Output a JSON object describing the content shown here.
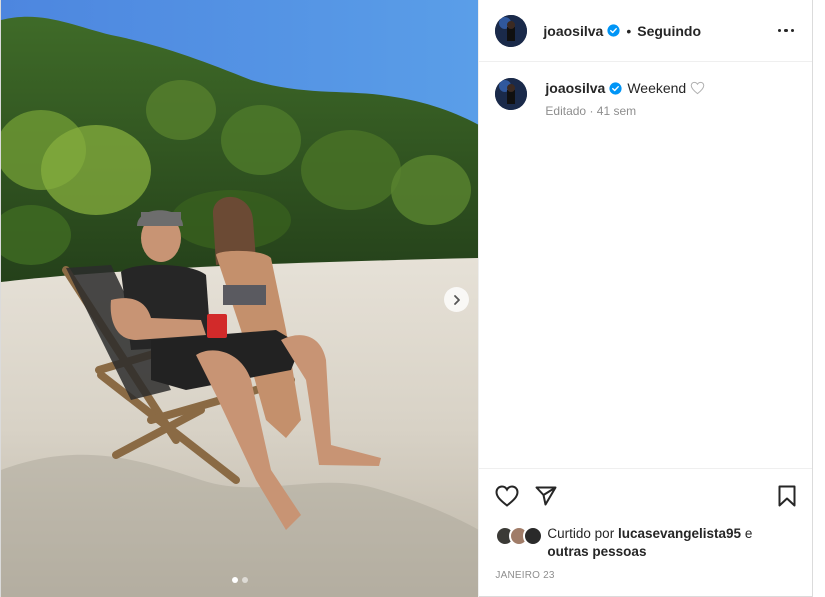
{
  "post": {
    "username": "joaosilva",
    "follow_separator": "•",
    "follow_state": "Seguindo",
    "more_icon": "more-horizontal-icon",
    "caption": {
      "username": "joaosilva",
      "text": "Weekend",
      "meta": "Editado · 41 sem"
    },
    "likes": {
      "prefix": "Curtido por",
      "user": "lucasevangelista95",
      "conjunction": "e",
      "others": "outras pessoas"
    },
    "date": "JANEIRO 23",
    "carousel": {
      "count": 2,
      "active_index": 0
    },
    "icons": [
      "like-heart-icon",
      "share-send-icon",
      "save-bookmark-icon",
      "verified-badge-icon",
      "carousel-next-icon"
    ]
  },
  "colors": {
    "text": "#262626",
    "muted": "#8e8e8e",
    "verified": "#0095f6",
    "border": "#dbdbdb"
  }
}
